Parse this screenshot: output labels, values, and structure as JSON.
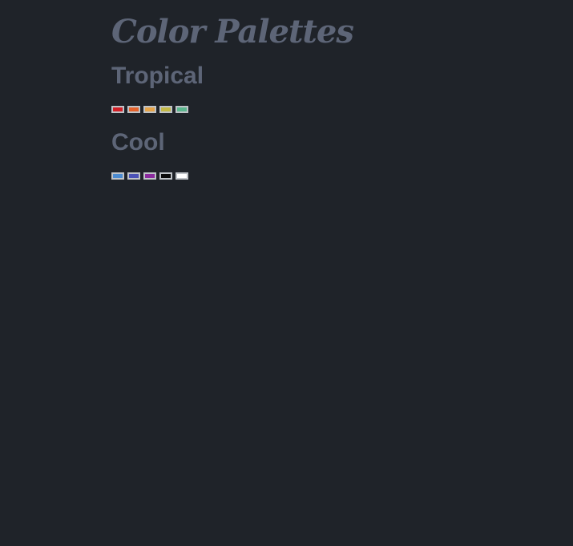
{
  "page": {
    "title": "Color Palettes"
  },
  "palettes": [
    {
      "name": "Tropical",
      "colors": [
        "#d21f26",
        "#e4622b",
        "#e6a449",
        "#c3b947",
        "#5bb68d"
      ]
    },
    {
      "name": "Cool",
      "colors": [
        "#4b8bd1",
        "#4b52b7",
        "#8a2a9e",
        "#0b0b0b",
        "#ffffff"
      ]
    }
  ]
}
